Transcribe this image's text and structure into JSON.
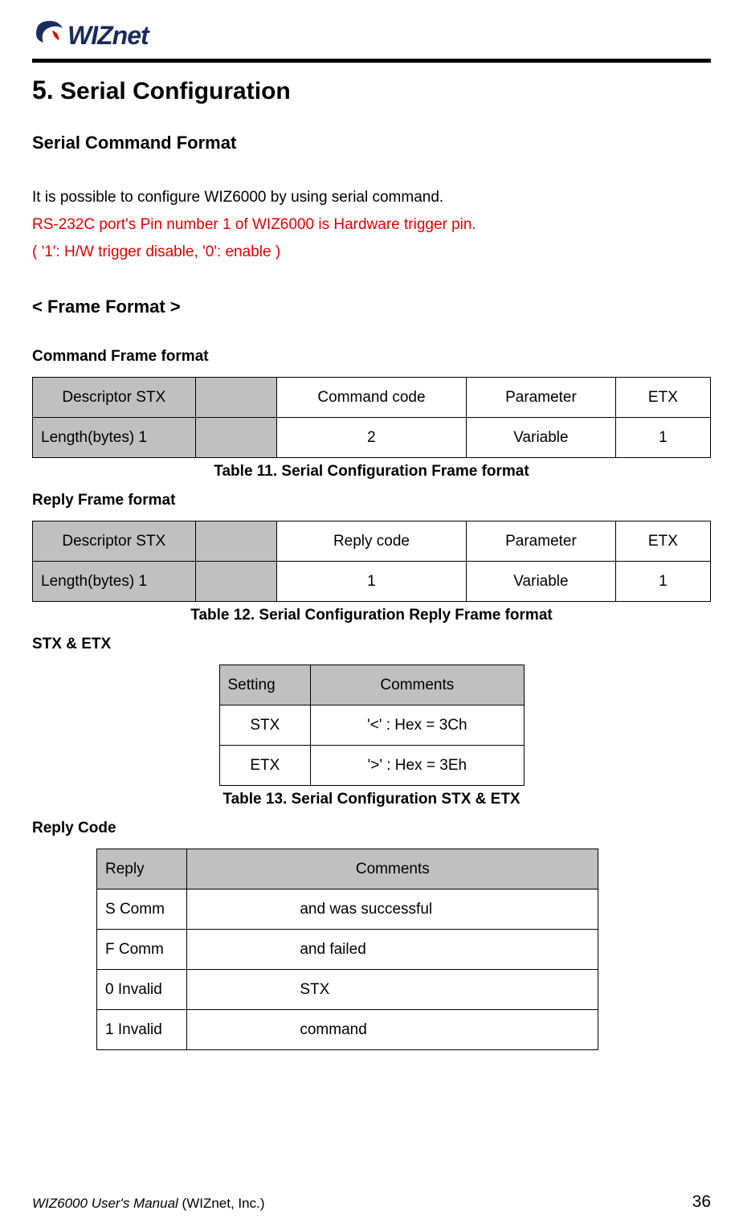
{
  "logo": {
    "name": "WIZnet"
  },
  "section": {
    "number": "5.",
    "title": "Serial Configuration"
  },
  "subsection": "Serial Command Format",
  "intro1": "It is possible to configure WIZ6000 by using serial command.",
  "intro2": "RS-232C port's Pin number 1 of WIZ6000 is Hardware trigger pin.",
  "intro3": "( '1': H/W trigger disable, '0': enable )",
  "bracket": "< Frame Format >",
  "commandFrame": {
    "title": "Command Frame format",
    "headers": [
      "Descriptor STX",
      "",
      "Command code",
      "Parameter",
      "ETX"
    ],
    "row": [
      "Length(bytes) 1",
      "",
      "2",
      "Variable",
      "1"
    ],
    "caption": "Table 11. Serial Configuration Frame format"
  },
  "replyFrame": {
    "title": "Reply Frame format",
    "headers": [
      "Descriptor STX",
      "",
      "Reply code",
      "Parameter",
      "ETX"
    ],
    "row": [
      "Length(bytes) 1",
      "",
      "1",
      "Variable",
      "1"
    ],
    "caption": "Table 12. Serial Configuration Reply Frame format"
  },
  "stxEtx": {
    "title": "STX & ETX",
    "headers": [
      "Setting",
      "Comments"
    ],
    "rows": [
      [
        "STX",
        "'<' : Hex = 3Ch"
      ],
      [
        "ETX",
        "'>' : Hex = 3Eh"
      ]
    ],
    "caption": "Table 13. Serial Configuration STX & ETX"
  },
  "replyCode": {
    "title": "Reply Code",
    "headers": [
      "Reply",
      "Comments"
    ],
    "rows": [
      [
        "S Comm",
        "and was successful"
      ],
      [
        "F Comm",
        "and failed"
      ],
      [
        "0 Invalid",
        " STX"
      ],
      [
        "1 Invalid",
        " command"
      ]
    ]
  },
  "footer": {
    "manual": "WIZ6000 User's Manual",
    "company": " (WIZnet, Inc.)",
    "page": "36"
  }
}
